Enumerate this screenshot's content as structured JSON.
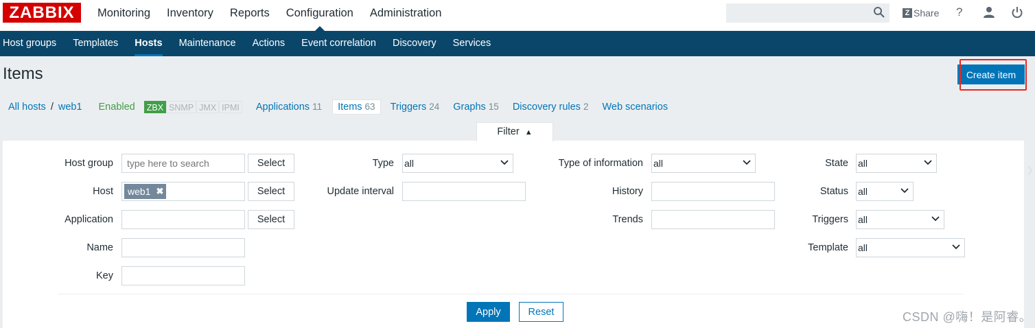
{
  "brand": {
    "logo": "ZABBIX"
  },
  "top_nav": [
    "Monitoring",
    "Inventory",
    "Reports",
    "Configuration",
    "Administration"
  ],
  "top_nav_active": "Configuration",
  "search": {
    "placeholder": "",
    "value": ""
  },
  "header_actions": {
    "share": "Share",
    "help": "?"
  },
  "sub_nav": [
    "Host groups",
    "Templates",
    "Hosts",
    "Maintenance",
    "Actions",
    "Event correlation",
    "Discovery",
    "Services"
  ],
  "sub_nav_active": "Hosts",
  "page": {
    "title": "Items",
    "create_button": "Create item"
  },
  "host_nav": {
    "all_hosts": "All hosts",
    "separator": "/",
    "host": "web1",
    "status": "Enabled",
    "availability": [
      "ZBX",
      "SNMP",
      "JMX",
      "IPMI"
    ],
    "tabs": [
      {
        "label": "Applications",
        "count": "11"
      },
      {
        "label": "Items",
        "count": "63"
      },
      {
        "label": "Triggers",
        "count": "24"
      },
      {
        "label": "Graphs",
        "count": "15"
      },
      {
        "label": "Discovery rules",
        "count": "2"
      },
      {
        "label": "Web scenarios",
        "count": ""
      }
    ]
  },
  "filter": {
    "tab_label": "Filter",
    "host_group": {
      "label": "Host group",
      "placeholder": "type here to search",
      "button": "Select"
    },
    "host": {
      "label": "Host",
      "chip": "web1",
      "button": "Select"
    },
    "application": {
      "label": "Application",
      "button": "Select"
    },
    "name": {
      "label": "Name"
    },
    "key": {
      "label": "Key"
    },
    "type": {
      "label": "Type",
      "value": "all"
    },
    "update_interval": {
      "label": "Update interval"
    },
    "type_of_information": {
      "label": "Type of information",
      "value": "all"
    },
    "history": {
      "label": "History"
    },
    "trends": {
      "label": "Trends"
    },
    "state": {
      "label": "State",
      "value": "all"
    },
    "status": {
      "label": "Status",
      "value": "all"
    },
    "triggers": {
      "label": "Triggers",
      "value": "all"
    },
    "template": {
      "label": "Template",
      "value": "all"
    },
    "apply": "Apply",
    "reset": "Reset"
  },
  "watermark": "CSDN @嗨！是阿睿。",
  "colors": {
    "brand_red": "#d40000",
    "nav_blue": "#0a466a",
    "link_blue": "#0275b8",
    "enabled_green": "#429e47",
    "highlight_red": "#e8271d"
  }
}
